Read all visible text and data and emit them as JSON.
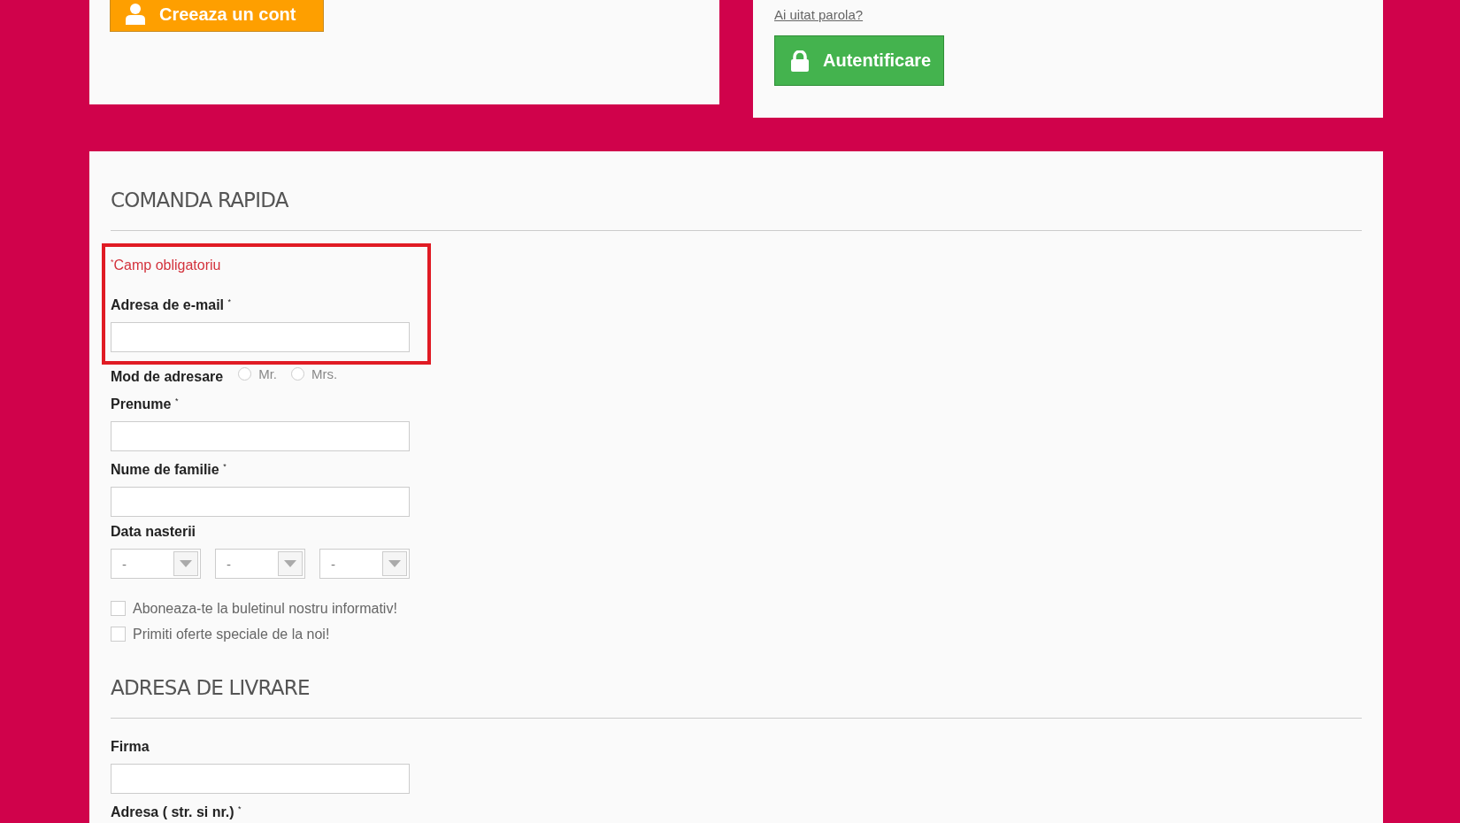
{
  "account_card": {
    "create_button": "Creeaza un cont"
  },
  "login_card": {
    "forgot_link": "Ai uitat parola?",
    "login_button": "Autentificare"
  },
  "quick_order": {
    "title": "COMANDA RAPIDA",
    "highlighted": true,
    "required_note": "$^{*}$Camp obligatoriu",
    "email": {
      "label": "Adresa de e-mail $^{*}$"
    },
    "salutation": {
      "label": "Mod de adresare",
      "options": [
        {
          "label": "Mr.",
          "selected": false
        },
        {
          "label": "Mrs.",
          "selected": false
        }
      ]
    },
    "first_name": {
      "label": "Prenume $^{*}$"
    },
    "last_name": {
      "label": "Nume de familie $^{*}$"
    },
    "birth_date": {
      "label": "Data nasterii",
      "selects": [
        "-",
        "-",
        "-"
      ]
    },
    "checkboxes": [
      {
        "label": "Aboneaza-te la buletinul nostru informativ!",
        "checked": false
      },
      {
        "label": "Primiti oferte speciale de la noi!",
        "checked": false
      }
    ]
  },
  "delivery": {
    "title": "ADRESA DE LIVRARE",
    "fields": [
      {
        "label": "Firma"
      },
      {
        "label": "Adresa ( str. si nr.) $^{*}$"
      }
    ]
  }
}
